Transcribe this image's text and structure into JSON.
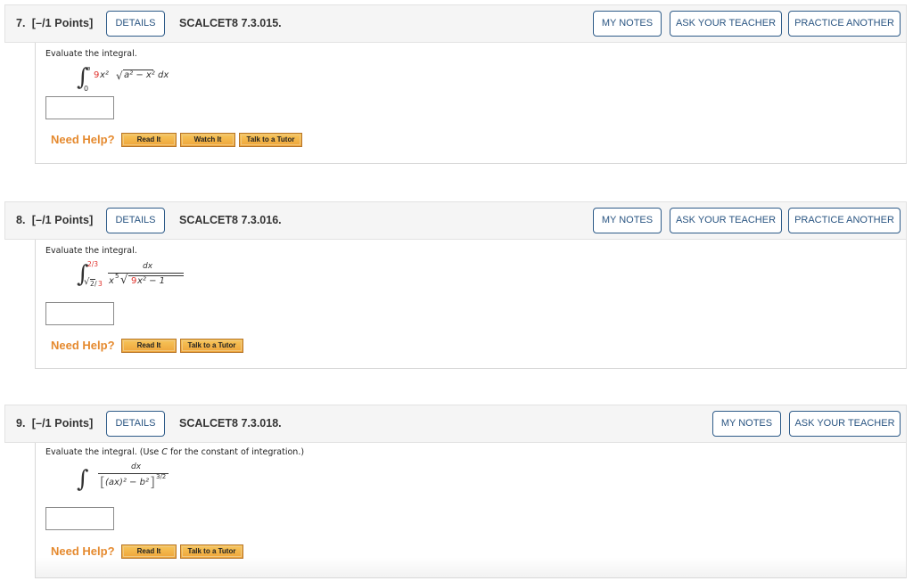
{
  "questions": [
    {
      "number": "7.",
      "points": "[–/1 Points]",
      "details_label": "DETAILS",
      "code": "SCALCET8 7.3.015.",
      "actions": [
        "MY NOTES",
        "ASK YOUR TEACHER",
        "PRACTICE ANOTHER"
      ],
      "prompt": "Evaluate the integral.",
      "integral": {
        "lower": "0",
        "upper": "a",
        "coef": "9",
        "integrand_rest": "x²",
        "sqrt_content": "a² − x²",
        "differential": "dx"
      },
      "answer_value": "",
      "need_help_label": "Need Help?",
      "help_buttons": [
        "Read It",
        "Watch It",
        "Talk to a Tutor"
      ]
    },
    {
      "number": "8.",
      "points": "[–/1 Points]",
      "details_label": "DETAILS",
      "code": "SCALCET8 7.3.016.",
      "actions": [
        "MY NOTES",
        "ASK YOUR TEACHER",
        "PRACTICE ANOTHER"
      ],
      "prompt": "Evaluate the integral.",
      "integral": {
        "upper": "2/3",
        "lower_sqrt": "2",
        "lower_rest": "/",
        "lower_den": "3",
        "numerator": "dx",
        "den_prefix": "x",
        "den_exp": "5",
        "sqrt_coef": "9",
        "sqrt_rest": "x² − 1"
      },
      "answer_value": "",
      "need_help_label": "Need Help?",
      "help_buttons": [
        "Read It",
        "Talk to a Tutor"
      ]
    },
    {
      "number": "9.",
      "points": "[–/1 Points]",
      "details_label": "DETAILS",
      "code": "SCALCET8 7.3.018.",
      "actions": [
        "MY NOTES",
        "ASK YOUR TEACHER"
      ],
      "prompt_pre": "Evaluate the integral. (Use ",
      "prompt_var": "C",
      "prompt_post": " for the constant of integration.)",
      "integral": {
        "numerator": "dx",
        "den_content": "(ax)² − b²",
        "exponent": "3/2"
      },
      "answer_value": "",
      "need_help_label": "Need Help?",
      "help_buttons": [
        "Read It",
        "Talk to a Tutor"
      ]
    }
  ],
  "colors": {
    "accent_blue": "#2a5582",
    "help_orange": "#e58a2f",
    "highlight_red": "#e0302a"
  }
}
